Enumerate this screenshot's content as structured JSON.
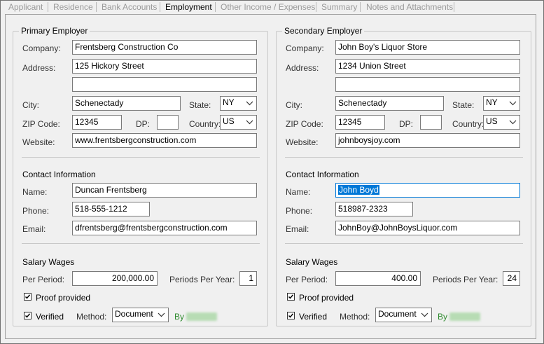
{
  "tabs": [
    {
      "label": "Applicant",
      "active": false
    },
    {
      "label": "Residence",
      "active": false
    },
    {
      "label": "Bank Accounts",
      "active": false
    },
    {
      "label": "Employment",
      "active": true
    },
    {
      "label": "Other Income / Expenses",
      "active": false
    },
    {
      "label": "Summary",
      "active": false
    },
    {
      "label": "Notes and Attachments",
      "active": false
    }
  ],
  "labels": {
    "company": "Company:",
    "address": "Address:",
    "city": "City:",
    "state": "State:",
    "zip": "ZIP Code:",
    "dp": "DP:",
    "country": "Country:",
    "website": "Website:",
    "contact_header": "Contact Information",
    "name": "Name:",
    "phone": "Phone:",
    "email": "Email:",
    "salary_header": "Salary Wages",
    "per_period": "Per Period:",
    "periods_per_year": "Periods Per Year:",
    "proof_provided": "Proof provided",
    "verified": "Verified",
    "method": "Method:",
    "by": "By"
  },
  "primary": {
    "title": "Primary Employer",
    "company": "Frentsberg Construction Co",
    "address1": "125 Hickory Street",
    "address2": "",
    "city": "Schenectady",
    "state": "NY",
    "zip": "12345",
    "dp": "",
    "country": "US",
    "website": "www.frentsbergconstruction.com",
    "contact_name": "Duncan Frentsberg",
    "phone": "518-555-1212",
    "email": "dfrentsberg@frentsbergconstruction.com",
    "per_period": "200,000.00",
    "periods_per_year": "1",
    "proof_provided": true,
    "verified": true,
    "method": "Document"
  },
  "secondary": {
    "title": "Secondary Employer",
    "company": "John Boy's Liquor Store",
    "address1": "1234 Union Street",
    "address2": "",
    "city": "Schenectady",
    "state": "NY",
    "zip": "12345",
    "dp": "",
    "country": "US",
    "website": "johnboysjoy.com",
    "contact_name": "John Boyd",
    "phone": "518987-2323",
    "email": "JohnBoy@JohnBoysLiquor.com",
    "per_period": "400.00",
    "periods_per_year": "24",
    "proof_provided": true,
    "verified": true,
    "method": "Document"
  },
  "colors": {
    "selection": "#0078d7",
    "verified_green": "#2e8b2e",
    "panel": "#f0f0f0"
  }
}
